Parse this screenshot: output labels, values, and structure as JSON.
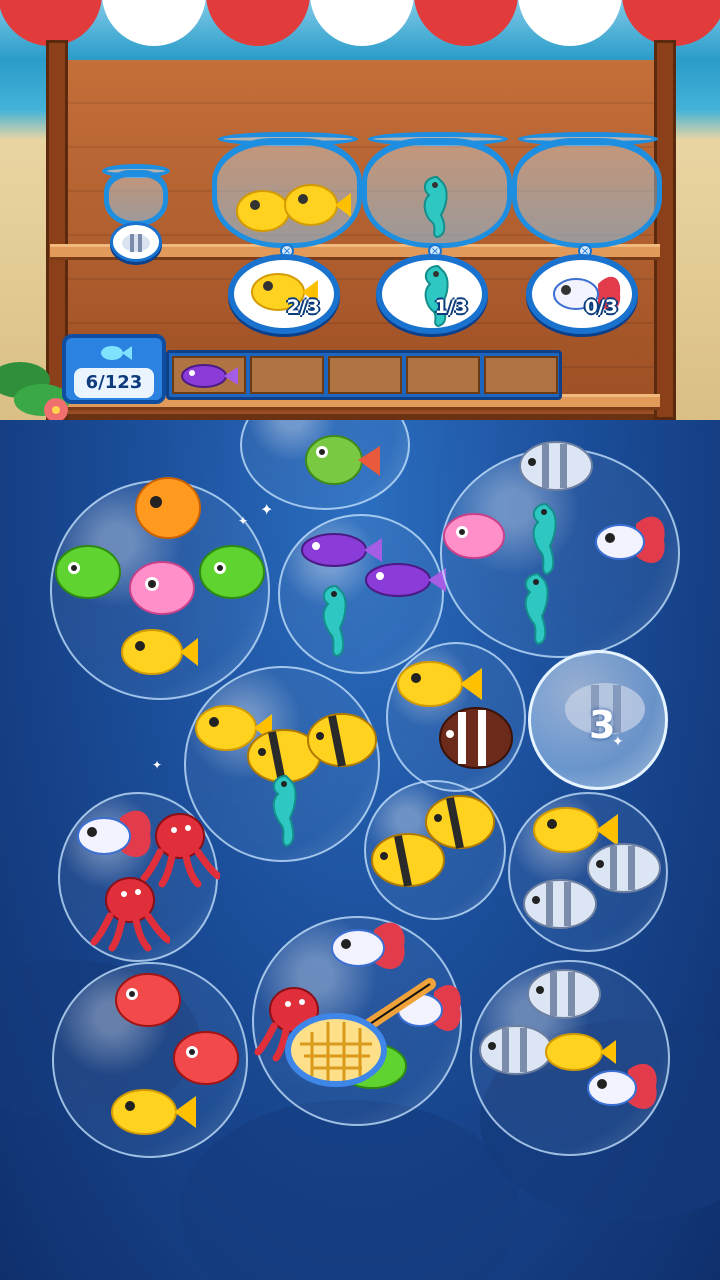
{
  "bowls": [
    {
      "fish": "yellow-puffer",
      "progress": "2/3"
    },
    {
      "fish": "seahorse",
      "progress": "1/3"
    },
    {
      "fish": "betta",
      "progress": "0/3"
    }
  ],
  "small_bowl": {
    "fish": "striped-angelfish"
  },
  "counter": {
    "icon": "fish-icon",
    "value": "6/123"
  },
  "slots": [
    "purple-fish",
    "",
    "",
    "",
    ""
  ],
  "lock_bubble": {
    "number": "3"
  },
  "colors": {
    "sea": "#1b4d99",
    "bowl_rim": "#1e8ee0",
    "badge_border": "#1a72cf",
    "wood": "#b07443"
  }
}
